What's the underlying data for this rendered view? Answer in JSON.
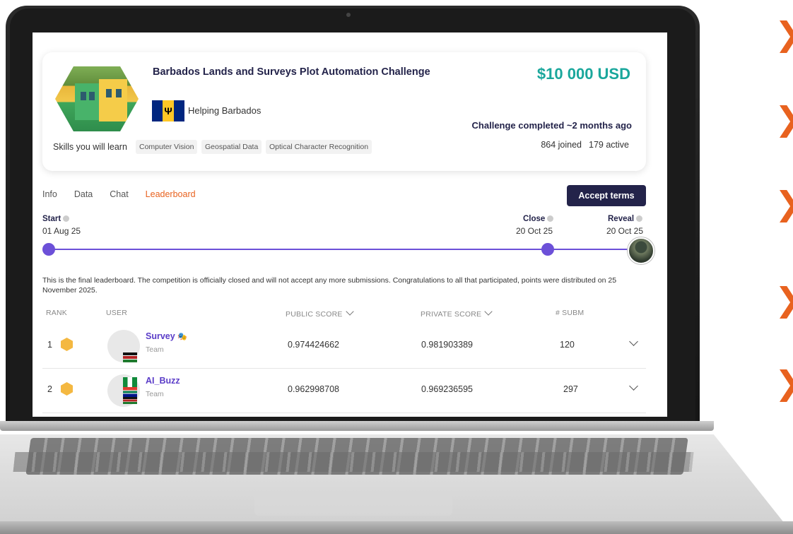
{
  "challenge": {
    "title": "Barbados Lands and Surveys Plot Automation Challenge",
    "prize": "$10 000 USD",
    "sponsor_text": "Helping Barbados",
    "status": "Challenge completed ~2 months ago",
    "joined": "864 joined",
    "active": "179 active",
    "skills_label": "Skills you will learn",
    "skills": [
      "Computer Vision",
      "Geospatial Data",
      "Optical Character Recognition"
    ],
    "flag_symbol": "Ψ"
  },
  "tabs": [
    {
      "label": "Info",
      "active": false
    },
    {
      "label": "Data",
      "active": false
    },
    {
      "label": "Chat",
      "active": false
    },
    {
      "label": "Leaderboard",
      "active": true
    }
  ],
  "accept_button": "Accept terms",
  "timeline": {
    "start_label": "Start",
    "start_date": "01 Aug 25",
    "close_label": "Close",
    "close_date": "20 Oct 25",
    "reveal_label": "Reveal",
    "reveal_date": "20 Oct 25"
  },
  "leaderboard": {
    "notice": "This is the final leaderboard. The competition is officially closed and will not accept any more submissions. Congratulations to all that participated, points were distributed on 25 November 2025.",
    "headers": {
      "rank": "RANK",
      "user": "USER",
      "public": "PUBLIC SCORE",
      "private": "PRIVATE SCORE",
      "subm": "# SUBM"
    },
    "rows": [
      {
        "rank": "1",
        "name": "Survey",
        "type": "Team",
        "public": "0.974424662",
        "private": "0.981903389",
        "subm": "120"
      },
      {
        "rank": "2",
        "name": "AI_Buzz",
        "type": "Team",
        "public": "0.962998708",
        "private": "0.969236595",
        "subm": "297"
      }
    ]
  },
  "colors": {
    "accent_orange": "#e8621f",
    "prize_teal": "#1aa79c",
    "navy": "#23234a",
    "timeline_purple": "#6c50d8",
    "medal_gold": "#f4b841"
  }
}
